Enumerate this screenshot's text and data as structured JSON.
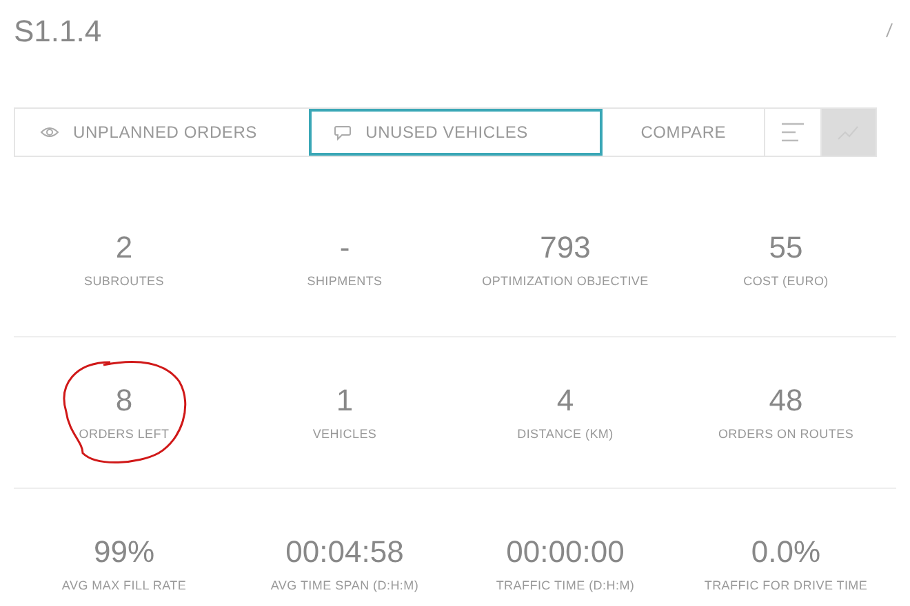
{
  "title": "S1.1.4",
  "toolbar": [
    {
      "kind": "iconed",
      "label": "UNPLANNED ORDERS",
      "selected": false
    },
    {
      "kind": "iconed",
      "label": "UNUSED VEHICLES",
      "selected": true
    },
    {
      "kind": "plain",
      "label": "COMPARE",
      "selected": false
    },
    {
      "kind": "view",
      "selected": false
    },
    {
      "kind": "view",
      "selected": true
    }
  ],
  "stat_rows": [
    [
      {
        "value": "2",
        "label": "SUBROUTES"
      },
      {
        "value": "-",
        "label": "SHIPMENTS"
      },
      {
        "value": "793",
        "label": "OPTIMIZATION OBJECTIVE"
      },
      {
        "value": "55",
        "label": "COST (EURO)"
      }
    ],
    [
      {
        "value": "8",
        "label": "ORDERS LEFT",
        "circled": true
      },
      {
        "value": "1",
        "label": "VEHICLES"
      },
      {
        "value": "4",
        "label": "DISTANCE (KM)"
      },
      {
        "value": "48",
        "label": "ORDERS ON ROUTES"
      }
    ],
    [
      {
        "value": "99%",
        "label": "AVG MAX FILL RATE"
      },
      {
        "value": "00:04:58",
        "label": "AVG TIME SPAN (D:H:M)"
      },
      {
        "value": "00:00:00",
        "label": "TRAFFIC TIME (D:H:M)"
      },
      {
        "value": "0.0%",
        "label": "TRAFFIC FOR DRIVE TIME"
      }
    ]
  ]
}
